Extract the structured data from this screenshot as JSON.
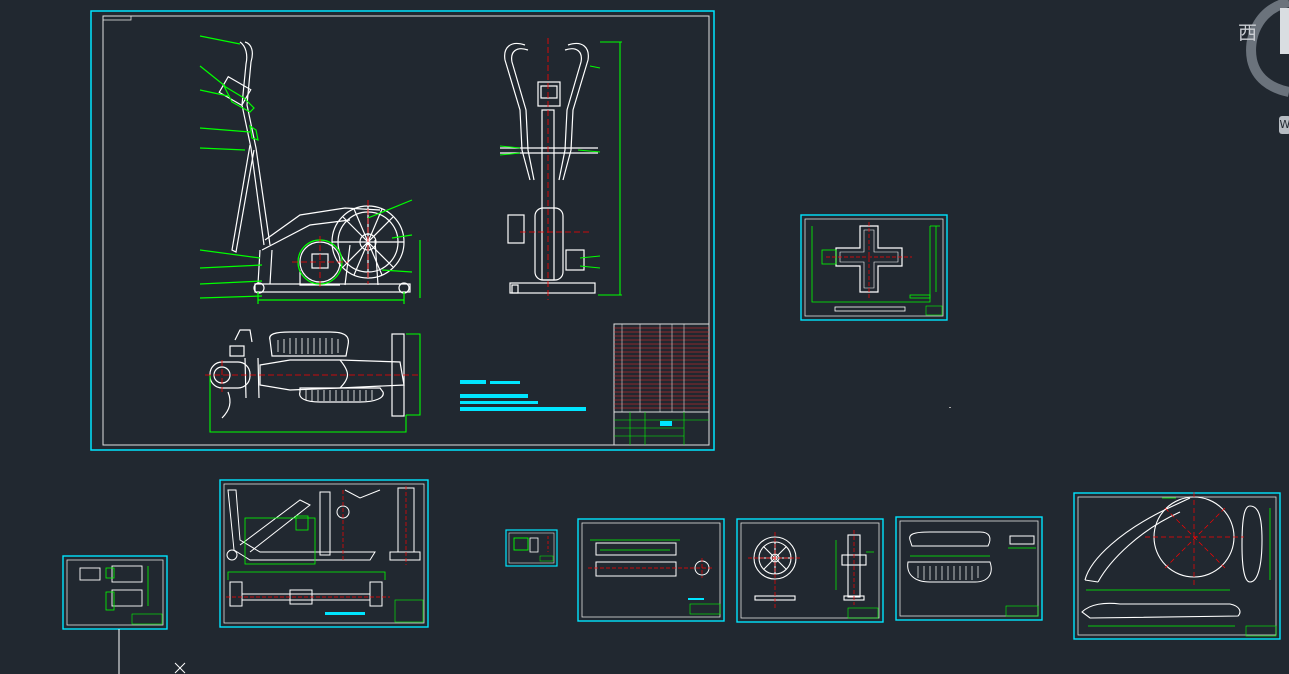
{
  "viewcube": {
    "direction_label": "西",
    "edge_label": "W"
  },
  "colors": {
    "background": "#212830",
    "frame": "#00e5ff",
    "border": "#d8d8d8",
    "geometry": "#ffffff",
    "dimension": "#00ff00",
    "centerline": "#ff0000",
    "title_bar": "#00e5ff"
  },
  "sheets": [
    "main-assembly-sheet",
    "cross-base-sheet",
    "frame-part-sheet",
    "small-part-sheet",
    "left-bottom-sheet",
    "shaft-sheet",
    "flywheel-sheet",
    "pedal-sheet",
    "guard-sheet"
  ]
}
